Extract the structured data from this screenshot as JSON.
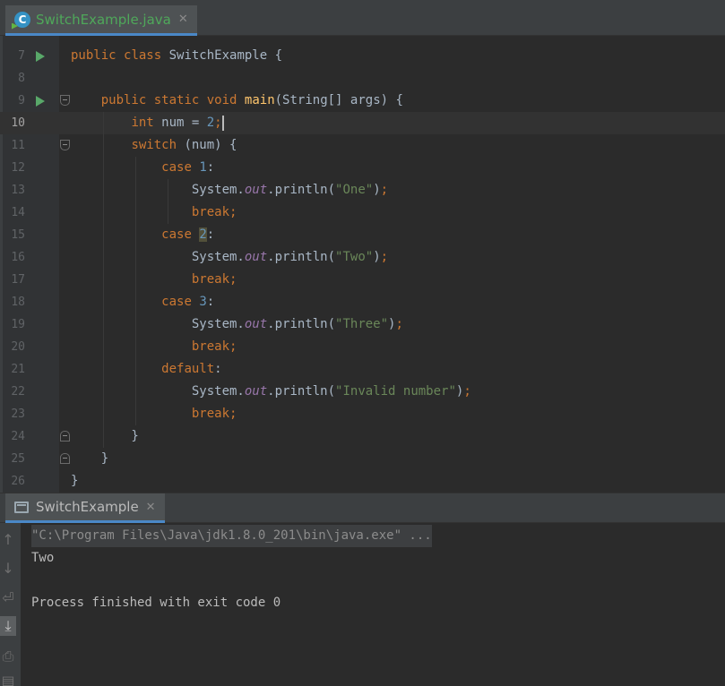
{
  "editor_tab": {
    "label": "SwitchExample.java",
    "close": "✕"
  },
  "run_tab": {
    "label": "SwitchExample",
    "close": "✕"
  },
  "editor": {
    "current_line": 10,
    "lines": [
      {
        "n": "7",
        "tokens": [
          [
            "kw",
            "public "
          ],
          [
            "kw",
            "class "
          ],
          [
            "plain",
            "SwitchExample {"
          ]
        ]
      },
      {
        "n": "8",
        "tokens": []
      },
      {
        "n": "9",
        "tokens": [
          [
            "plain",
            "    "
          ],
          [
            "kw",
            "public "
          ],
          [
            "kw",
            "static "
          ],
          [
            "kw",
            "void "
          ],
          [
            "fn",
            "main"
          ],
          [
            "plain",
            "(String[] args) {"
          ]
        ]
      },
      {
        "n": "10",
        "tokens": [
          [
            "plain",
            "        "
          ],
          [
            "kw",
            "int "
          ],
          [
            "plain",
            "num = "
          ],
          [
            "num",
            "2"
          ],
          [
            "kw",
            ";"
          ]
        ]
      },
      {
        "n": "11",
        "tokens": [
          [
            "plain",
            "        "
          ],
          [
            "kw",
            "switch "
          ],
          [
            "plain",
            "(num) {"
          ]
        ]
      },
      {
        "n": "12",
        "tokens": [
          [
            "plain",
            "            "
          ],
          [
            "kw",
            "case "
          ],
          [
            "num",
            "1"
          ],
          [
            "plain",
            ":"
          ]
        ]
      },
      {
        "n": "13",
        "tokens": [
          [
            "plain",
            "                System."
          ],
          [
            "fld",
            "out"
          ],
          [
            "plain",
            ".println("
          ],
          [
            "str",
            "\"One\""
          ],
          [
            "plain",
            ")"
          ],
          [
            "kw",
            ";"
          ]
        ]
      },
      {
        "n": "14",
        "tokens": [
          [
            "plain",
            "                "
          ],
          [
            "kw",
            "break;"
          ]
        ]
      },
      {
        "n": "15",
        "tokens": [
          [
            "plain",
            "            "
          ],
          [
            "kw",
            "case "
          ],
          [
            "numhl",
            "2"
          ],
          [
            "plain",
            ":"
          ]
        ]
      },
      {
        "n": "16",
        "tokens": [
          [
            "plain",
            "                System."
          ],
          [
            "fld",
            "out"
          ],
          [
            "plain",
            ".println("
          ],
          [
            "str",
            "\"Two\""
          ],
          [
            "plain",
            ")"
          ],
          [
            "kw",
            ";"
          ]
        ]
      },
      {
        "n": "17",
        "tokens": [
          [
            "plain",
            "                "
          ],
          [
            "kw",
            "break;"
          ]
        ]
      },
      {
        "n": "18",
        "tokens": [
          [
            "plain",
            "            "
          ],
          [
            "kw",
            "case "
          ],
          [
            "num",
            "3"
          ],
          [
            "plain",
            ":"
          ]
        ]
      },
      {
        "n": "19",
        "tokens": [
          [
            "plain",
            "                System."
          ],
          [
            "fld",
            "out"
          ],
          [
            "plain",
            ".println("
          ],
          [
            "str",
            "\"Three\""
          ],
          [
            "plain",
            ")"
          ],
          [
            "kw",
            ";"
          ]
        ]
      },
      {
        "n": "20",
        "tokens": [
          [
            "plain",
            "                "
          ],
          [
            "kw",
            "break;"
          ]
        ]
      },
      {
        "n": "21",
        "tokens": [
          [
            "plain",
            "            "
          ],
          [
            "kw",
            "default"
          ],
          [
            "plain",
            ":"
          ]
        ]
      },
      {
        "n": "22",
        "tokens": [
          [
            "plain",
            "                System."
          ],
          [
            "fld",
            "out"
          ],
          [
            "plain",
            ".println("
          ],
          [
            "str",
            "\"Invalid number\""
          ],
          [
            "plain",
            ")"
          ],
          [
            "kw",
            ";"
          ]
        ]
      },
      {
        "n": "23",
        "tokens": [
          [
            "plain",
            "                "
          ],
          [
            "kw",
            "break;"
          ]
        ]
      },
      {
        "n": "24",
        "tokens": [
          [
            "plain",
            "        }"
          ]
        ]
      },
      {
        "n": "25",
        "tokens": [
          [
            "plain",
            "    }"
          ]
        ]
      },
      {
        "n": "26",
        "tokens": [
          [
            "plain",
            "}"
          ]
        ]
      }
    ]
  },
  "console": {
    "command": "\"C:\\Program Files\\Java\\jdk1.8.0_201\\bin\\java.exe\" ...",
    "output": "Two",
    "exit_message": "Process finished with exit code 0"
  },
  "toolbar_icons": [
    "up-arrow-icon",
    "down-arrow-icon",
    "soft-wrap-icon",
    "scroll-to-end-icon",
    "print-icon",
    "clear-icon"
  ],
  "colors": {
    "keyword": "#cc7832",
    "number": "#6897bb",
    "string": "#6a8759",
    "method": "#ffc66d",
    "field": "#9876aa",
    "accent": "#4a88c7"
  }
}
